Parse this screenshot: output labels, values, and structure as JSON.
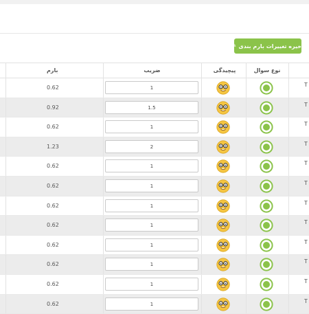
{
  "toolbar": {
    "save_label": "ذخیره تغییرات بارم بندی",
    "edit_icon": "edit-icon"
  },
  "table": {
    "headers": {
      "barem": "بارم",
      "coef": "ضریب",
      "difficulty": "پیچیدگی",
      "question_type": "نوع سوال"
    },
    "rows": [
      {
        "barem": "0.62",
        "coef": "1",
        "title_fragment": "T"
      },
      {
        "barem": "0.92",
        "coef": "1.5",
        "title_fragment": "T"
      },
      {
        "barem": "0.62",
        "coef": "1",
        "title_fragment": "T"
      },
      {
        "barem": "1.23",
        "coef": "2",
        "title_fragment": "T"
      },
      {
        "barem": "0.62",
        "coef": "1",
        "title_fragment": "T"
      },
      {
        "barem": "0.62",
        "coef": "1",
        "title_fragment": "T"
      },
      {
        "barem": "0.62",
        "coef": "1",
        "title_fragment": "T"
      },
      {
        "barem": "0.62",
        "coef": "1",
        "title_fragment": "T"
      },
      {
        "barem": "0.62",
        "coef": "1",
        "title_fragment": "T"
      },
      {
        "barem": "0.62",
        "coef": "1",
        "title_fragment": "T"
      },
      {
        "barem": "0.62",
        "coef": "1",
        "title_fragment": "T"
      },
      {
        "barem": "0.62",
        "coef": "1",
        "title_fragment": "T"
      }
    ]
  },
  "colors": {
    "accent": "#8bc34a",
    "row_alt": "#ececec",
    "emoji": "#f5c542"
  },
  "icons": {
    "difficulty": "nerd-face-icon",
    "question_type": "radio-circle-icon"
  }
}
